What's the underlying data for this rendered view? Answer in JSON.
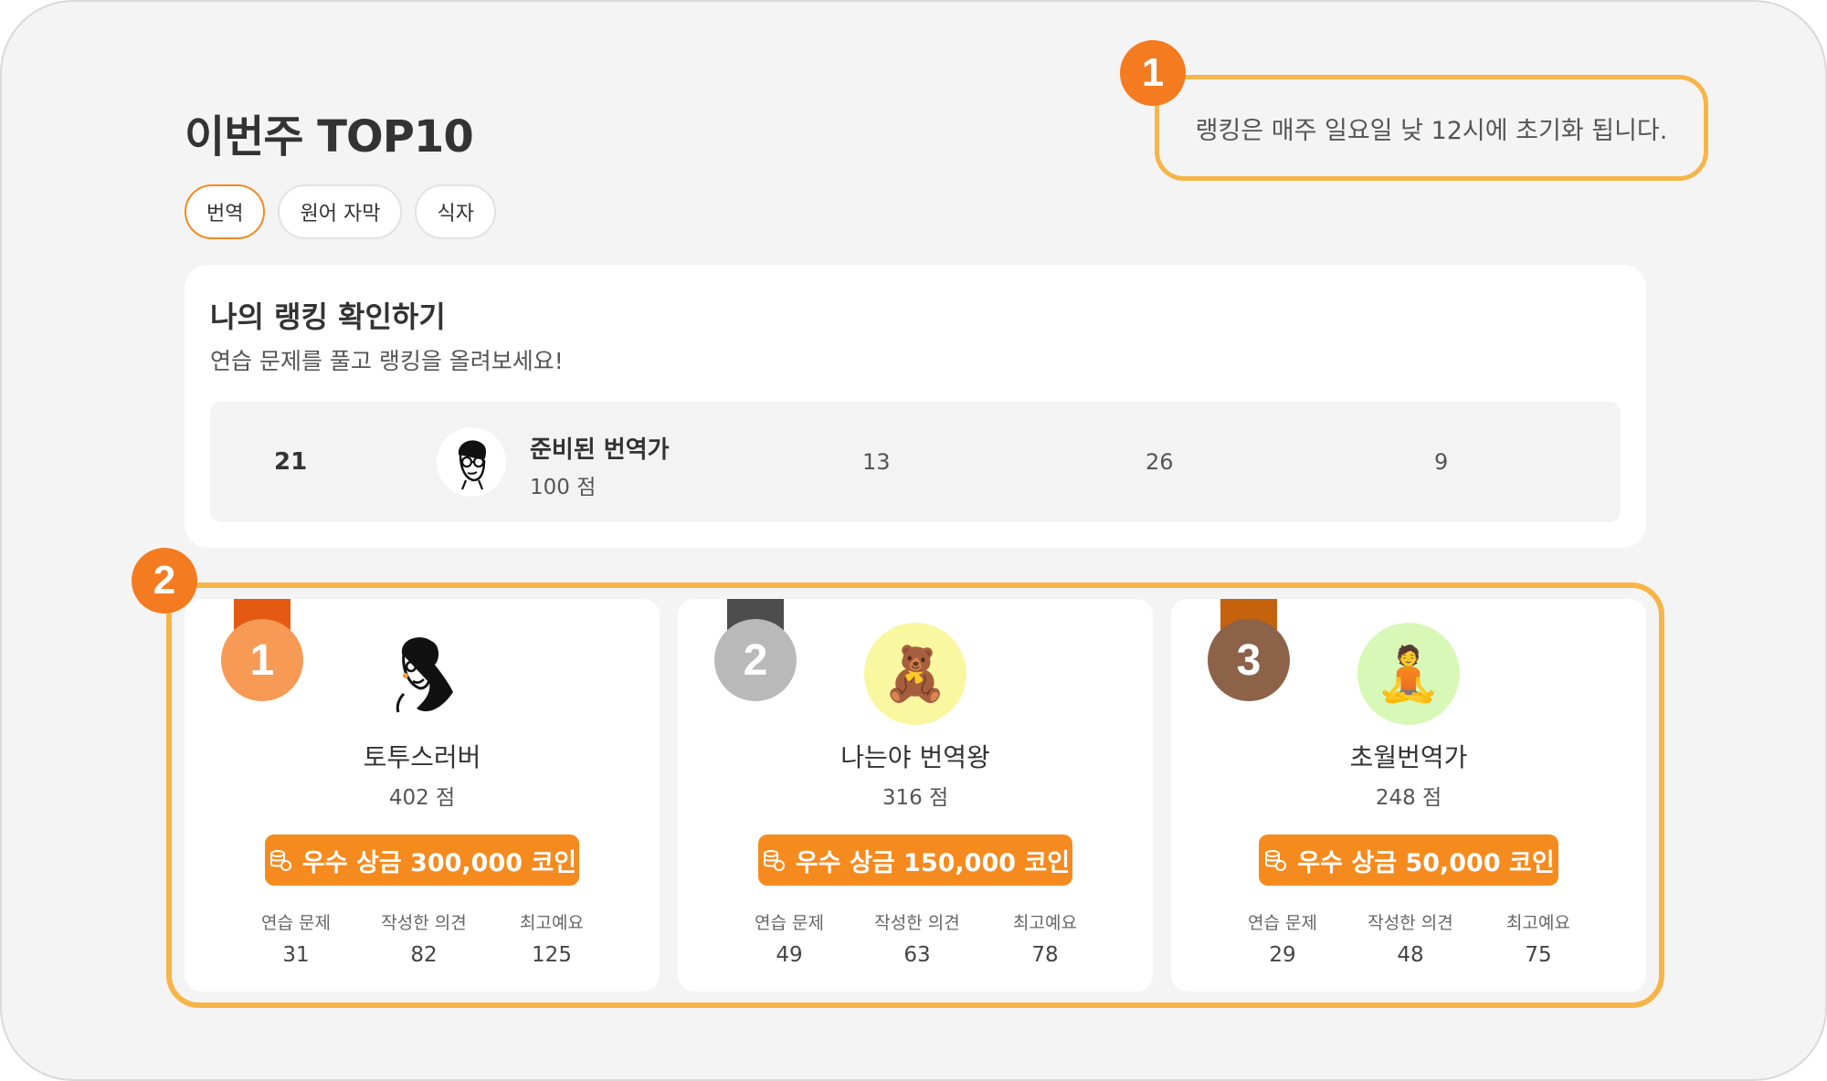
{
  "page_title": "이번주 TOP10",
  "tabs": [
    "번역",
    "원어 자막",
    "식자"
  ],
  "callouts": {
    "one": "1",
    "two": "2"
  },
  "notice": "랭킹은 매주 일요일 낮 12시에 초기화 됩니다.",
  "my_ranking": {
    "title": "나의 랭킹 확인하기",
    "subtitle": "연습 문제를 풀고 랭킹을 올려보세요!",
    "rank": "21",
    "name": "준비된 번역가",
    "score": "100 점",
    "stat1": "13",
    "stat2": "26",
    "stat3": "9"
  },
  "top3": [
    {
      "medal": "1",
      "medal_color": "#f79a55",
      "ribbon_color": "#e55a12",
      "avatar_icon": "sketch-man-icon",
      "avatar_bg": "#ffffff",
      "name": "토투스러버",
      "score": "402 점",
      "prize": "우수 상금 300,000 코인",
      "stats": [
        {
          "label": "연습 문제",
          "value": "31"
        },
        {
          "label": "작성한 의견",
          "value": "82"
        },
        {
          "label": "최고예요",
          "value": "125"
        }
      ]
    },
    {
      "medal": "2",
      "medal_color": "#b9b9b9",
      "ribbon_color": "#4d4d4d",
      "avatar_icon": "teddy-bear-icon",
      "avatar_glyph": "🧸",
      "avatar_bg": "#f9f7a0",
      "name": "나는야 번역왕",
      "score": "316 점",
      "prize": "우수 상금 150,000 코인",
      "stats": [
        {
          "label": "연습 문제",
          "value": "49"
        },
        {
          "label": "작성한 의견",
          "value": "63"
        },
        {
          "label": "최고예요",
          "value": "78"
        }
      ]
    },
    {
      "medal": "3",
      "medal_color": "#8c6248",
      "ribbon_color": "#c4620e",
      "avatar_icon": "meditating-person-icon",
      "avatar_glyph": "🧘",
      "avatar_bg": "#d8f8b8",
      "name": "초월번역가",
      "score": "248 점",
      "prize": "우수 상금 50,000 코인",
      "stats": [
        {
          "label": "연습 문제",
          "value": "29"
        },
        {
          "label": "작성한 의견",
          "value": "48"
        },
        {
          "label": "최고예요",
          "value": "75"
        }
      ]
    }
  ],
  "colors": {
    "accent": "#f58b1f",
    "callout": "#f47b20",
    "highlight_border": "#f7b548"
  }
}
